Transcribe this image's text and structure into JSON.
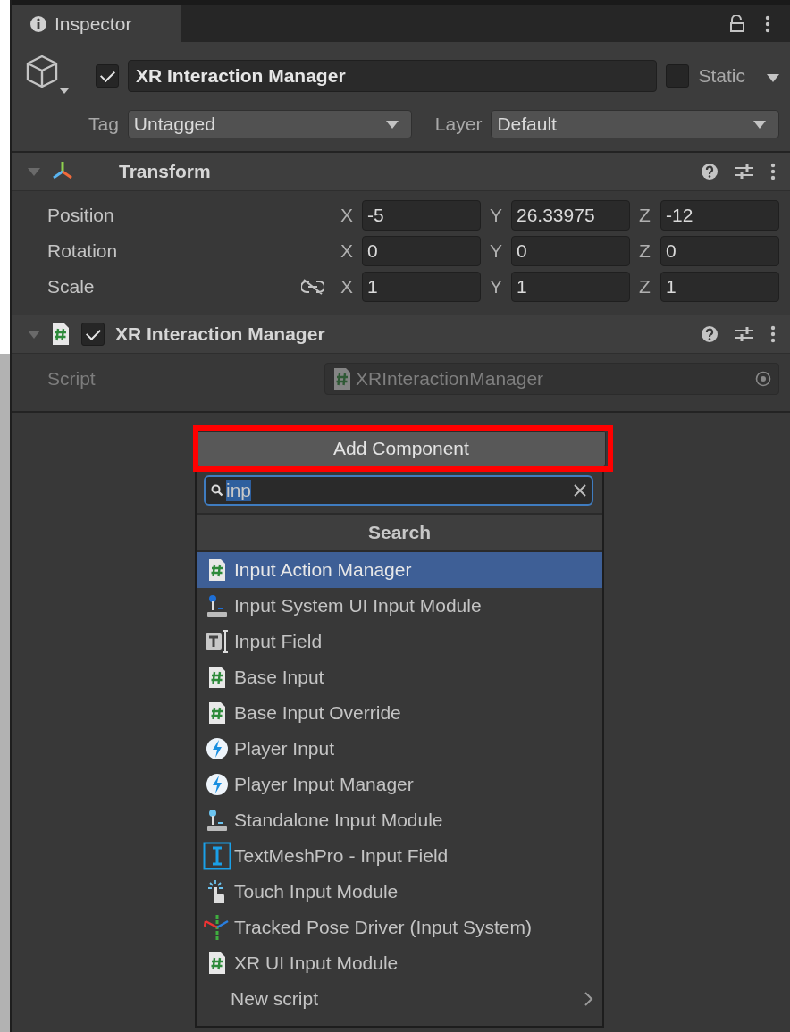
{
  "tab": {
    "label": "Inspector"
  },
  "header": {
    "active": true,
    "name": "XR Interaction Manager",
    "static": false,
    "static_label": "Static",
    "tag_label": "Tag",
    "tag": "Untagged",
    "layer_label": "Layer",
    "layer": "Default"
  },
  "components": [
    {
      "kind": "transform",
      "title": "Transform",
      "expanded": true,
      "rows": [
        {
          "label": "Position",
          "linked": false,
          "fields": [
            {
              "axis": "X",
              "value": "-5"
            },
            {
              "axis": "Y",
              "value": "26.33975"
            },
            {
              "axis": "Z",
              "value": "-12"
            }
          ]
        },
        {
          "label": "Rotation",
          "linked": false,
          "fields": [
            {
              "axis": "X",
              "value": "0"
            },
            {
              "axis": "Y",
              "value": "0"
            },
            {
              "axis": "Z",
              "value": "0"
            }
          ]
        },
        {
          "label": "Scale",
          "linked": true,
          "fields": [
            {
              "axis": "X",
              "value": "1"
            },
            {
              "axis": "Y",
              "value": "1"
            },
            {
              "axis": "Z",
              "value": "1"
            }
          ]
        }
      ]
    },
    {
      "kind": "script",
      "title": "XR Interaction Manager",
      "expanded": true,
      "enabled": true,
      "script_label": "Script",
      "script_value": "XRInteractionManager"
    }
  ],
  "add_component": {
    "label": "Add Component",
    "highlighted": true
  },
  "popup": {
    "search_value": "inp",
    "search_selected": true,
    "section": "Search",
    "items": [
      {
        "label": "Input Action Manager",
        "kind": "script",
        "selected": true
      },
      {
        "label": "Input System UI Input Module",
        "kind": "joystick",
        "selected": false
      },
      {
        "label": "Input Field",
        "kind": "inputfield",
        "selected": false
      },
      {
        "label": "Base Input",
        "kind": "script",
        "selected": false
      },
      {
        "label": "Base Input Override",
        "kind": "script",
        "selected": false
      },
      {
        "label": "Player Input",
        "kind": "bolt",
        "selected": false
      },
      {
        "label": "Player Input Manager",
        "kind": "bolt",
        "selected": false
      },
      {
        "label": "Standalone Input Module",
        "kind": "joystick2",
        "selected": false
      },
      {
        "label": "TextMeshPro - Input Field",
        "kind": "tmp",
        "selected": false
      },
      {
        "label": "Touch Input Module",
        "kind": "touch",
        "selected": false
      },
      {
        "label": "Tracked Pose Driver (Input System)",
        "kind": "pose",
        "selected": false
      },
      {
        "label": "XR UI Input Module",
        "kind": "script",
        "selected": false
      }
    ],
    "new_script": {
      "label": "New script"
    }
  }
}
